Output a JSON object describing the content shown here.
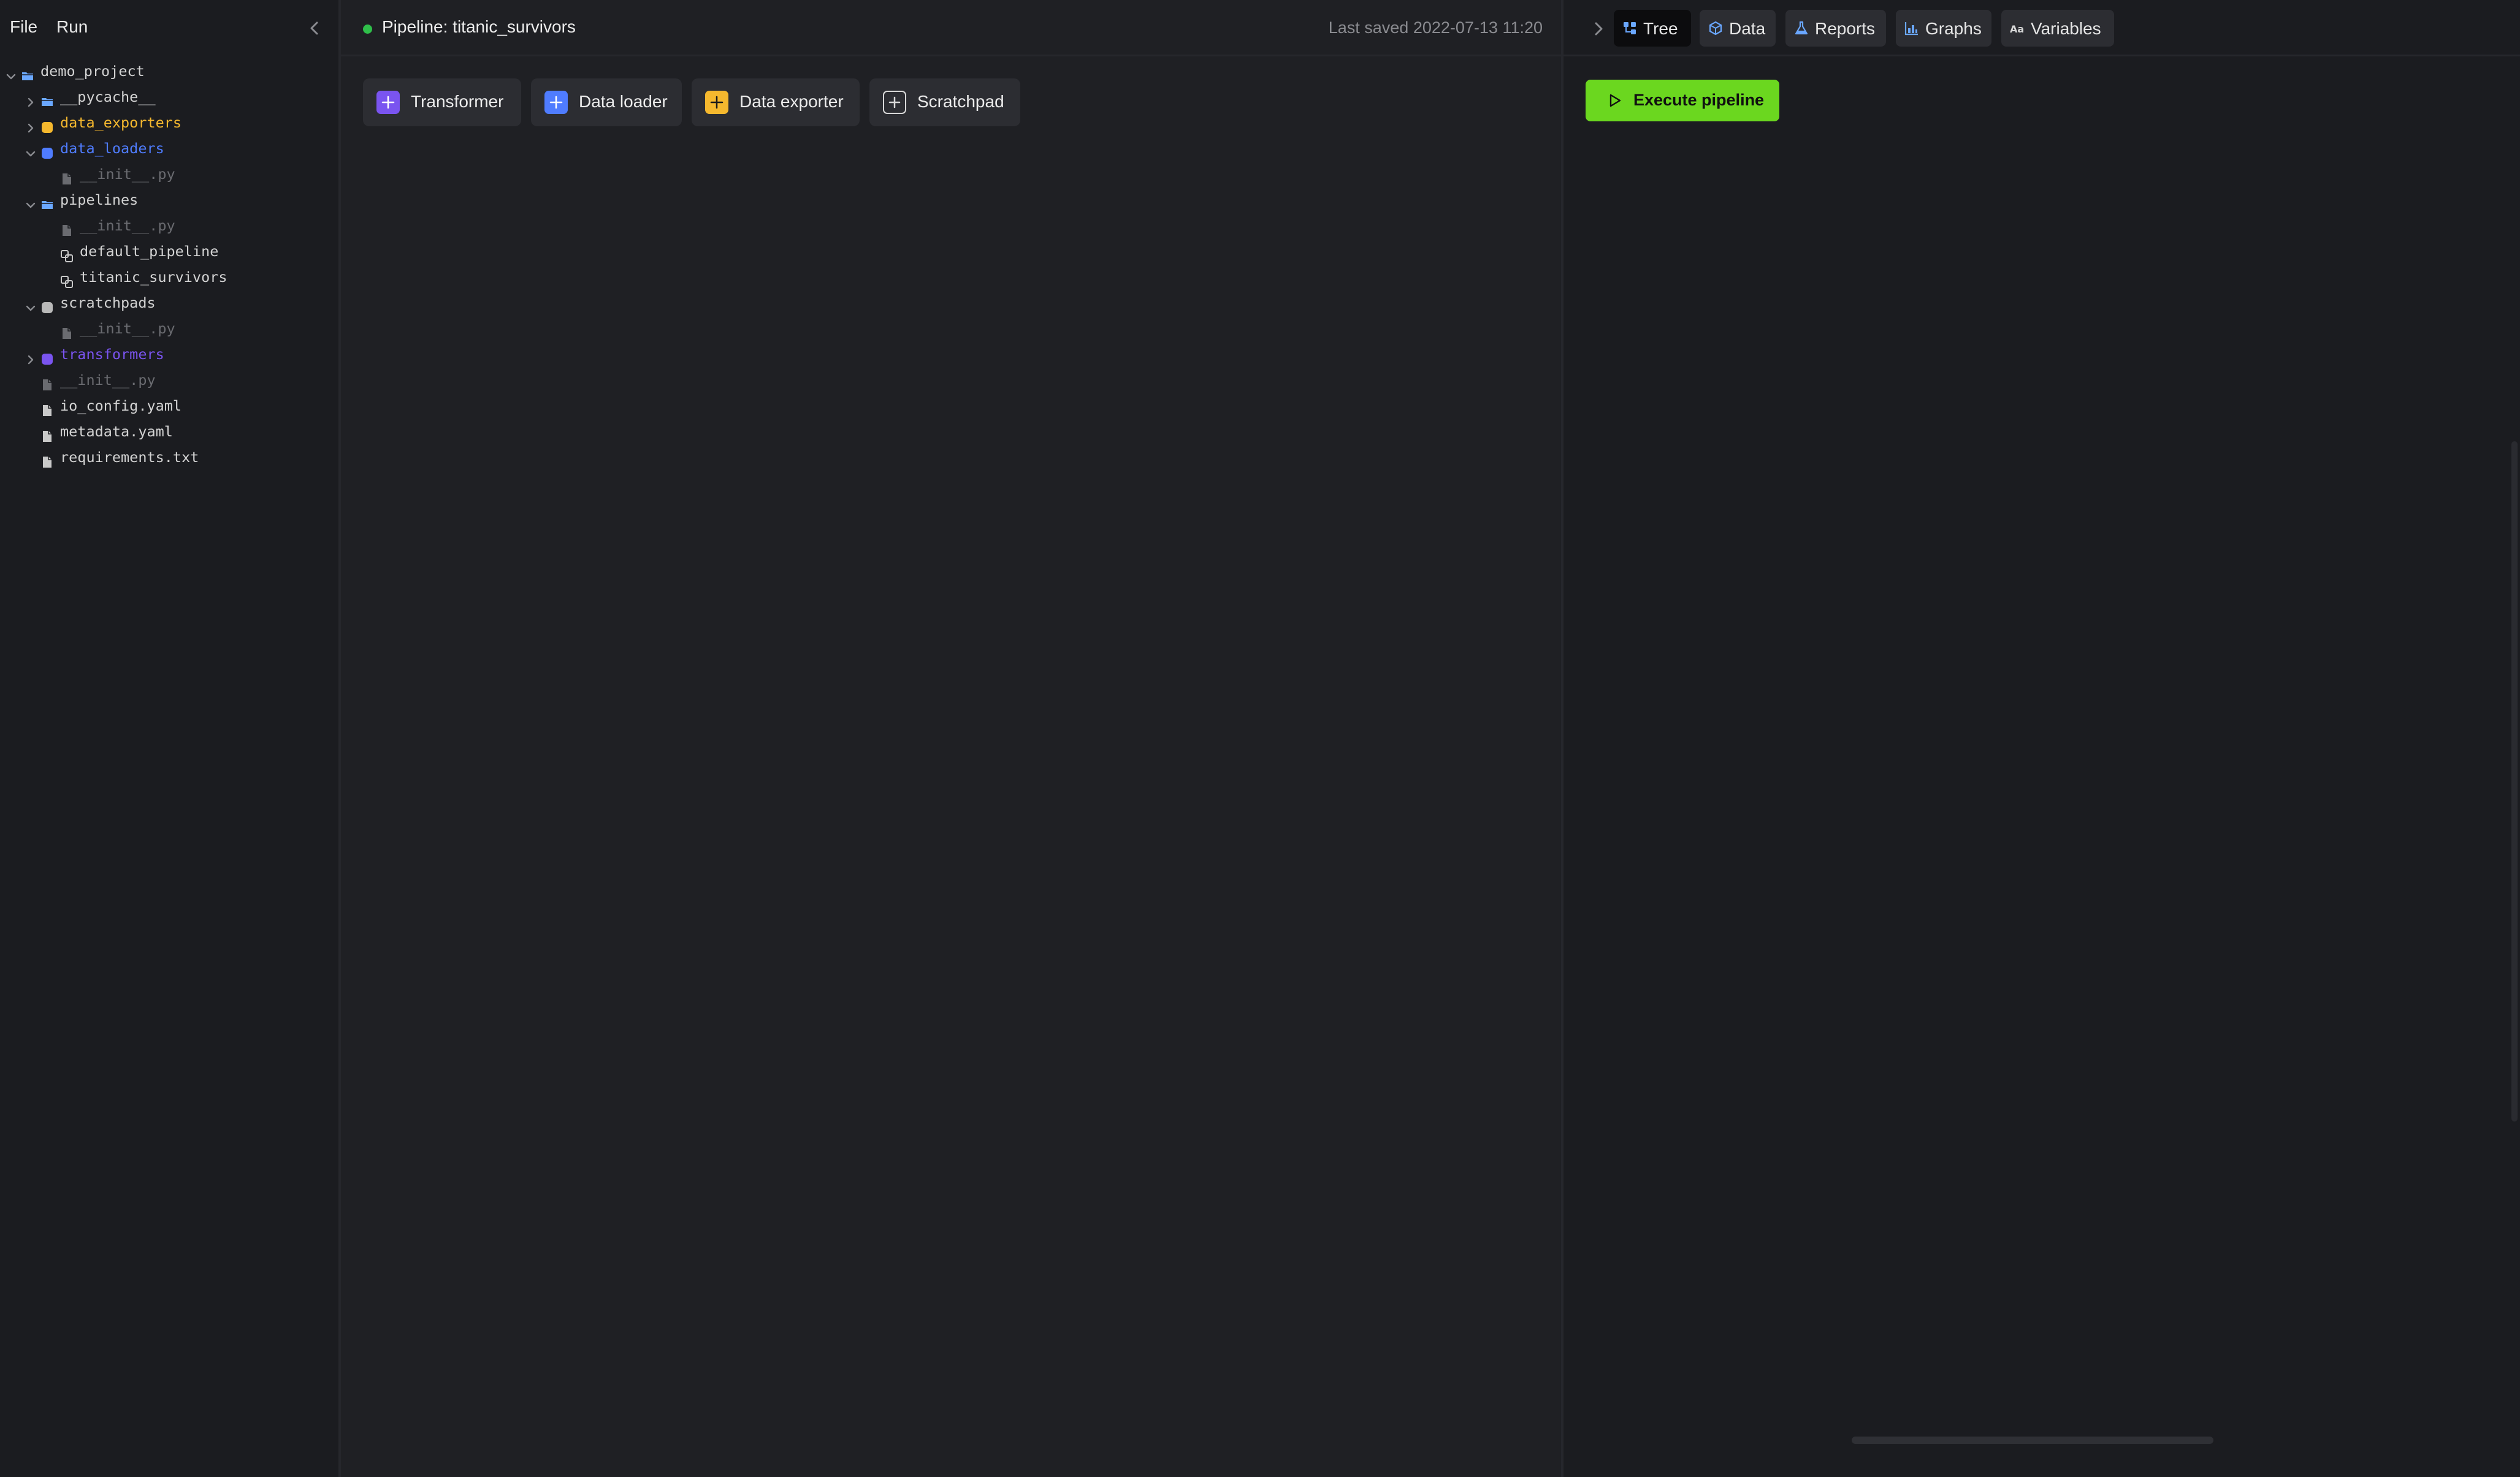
{
  "menu": {
    "file": "File",
    "run": "Run"
  },
  "file_tree": [
    {
      "label": "demo_project",
      "kind": "folder",
      "color": "#6aa7ff",
      "caret": "open",
      "depth": 0
    },
    {
      "label": "__pycache__",
      "kind": "folder",
      "color": "#6aa7ff",
      "caret": "closed",
      "depth": 1
    },
    {
      "label": "data_exporters",
      "kind": "block-folder",
      "color": "#f5b82e",
      "caret": "closed",
      "depth": 1
    },
    {
      "label": "data_loaders",
      "kind": "block-folder",
      "color": "#4f7cff",
      "caret": "open",
      "depth": 1
    },
    {
      "label": "__init__.py",
      "kind": "file-muted",
      "color": "#6a6b70",
      "caret": "none",
      "depth": 2
    },
    {
      "label": "pipelines",
      "kind": "folder",
      "color": "#6aa7ff",
      "caret": "open",
      "depth": 1
    },
    {
      "label": "__init__.py",
      "kind": "file-muted",
      "color": "#6a6b70",
      "caret": "none",
      "depth": 2
    },
    {
      "label": "default_pipeline",
      "kind": "pipeline",
      "color": "#c9c9c9",
      "caret": "none",
      "depth": 2
    },
    {
      "label": "titanic_survivors",
      "kind": "pipeline",
      "color": "#c9c9c9",
      "caret": "none",
      "depth": 2
    },
    {
      "label": "scratchpads",
      "kind": "block-folder",
      "color": "#b9b9b9",
      "caret": "open",
      "depth": 1
    },
    {
      "label": "__init__.py",
      "kind": "file-muted",
      "color": "#6a6b70",
      "caret": "none",
      "depth": 2
    },
    {
      "label": "transformers",
      "kind": "block-folder",
      "color": "#7a54f0",
      "caret": "closed",
      "depth": 1
    },
    {
      "label": "__init__.py",
      "kind": "file-muted",
      "color": "#6a6b70",
      "caret": "none",
      "depth": 1
    },
    {
      "label": "io_config.yaml",
      "kind": "file",
      "color": "#c9c9c9",
      "caret": "none",
      "depth": 1
    },
    {
      "label": "metadata.yaml",
      "kind": "file",
      "color": "#c9c9c9",
      "caret": "none",
      "depth": 1
    },
    {
      "label": "requirements.txt",
      "kind": "file",
      "color": "#c9c9c9",
      "caret": "none",
      "depth": 1
    }
  ],
  "header": {
    "pipeline_title": "Pipeline: titanic_survivors",
    "last_saved": "Last saved 2022-07-13 11:20",
    "status_color": "#2fbf4a"
  },
  "add_blocks": [
    {
      "label": "Transformer",
      "icon": "plus-icon",
      "color": "#7a54f0"
    },
    {
      "label": "Data loader",
      "icon": "plus-icon",
      "color": "#4f7cff"
    },
    {
      "label": "Data exporter",
      "icon": "plus-icon",
      "color": "#f5b82e"
    },
    {
      "label": "Scratchpad",
      "icon": "plus-icon",
      "color": "outline"
    }
  ],
  "right_tabs": [
    {
      "label": "Tree",
      "icon": "tree-icon",
      "active": true
    },
    {
      "label": "Data",
      "icon": "data-icon",
      "active": false
    },
    {
      "label": "Reports",
      "icon": "flask-icon",
      "active": false
    },
    {
      "label": "Graphs",
      "icon": "bar-chart-icon",
      "active": false
    },
    {
      "label": "Variables",
      "icon": "text-icon",
      "active": false
    }
  ],
  "execute": {
    "label": "Execute pipeline",
    "color": "#6bd71f"
  },
  "colors": {
    "background": "#1f2024",
    "sidebar": "#1b1c20",
    "button": "#2c2d32",
    "active_tab": "#0c0c0e"
  }
}
